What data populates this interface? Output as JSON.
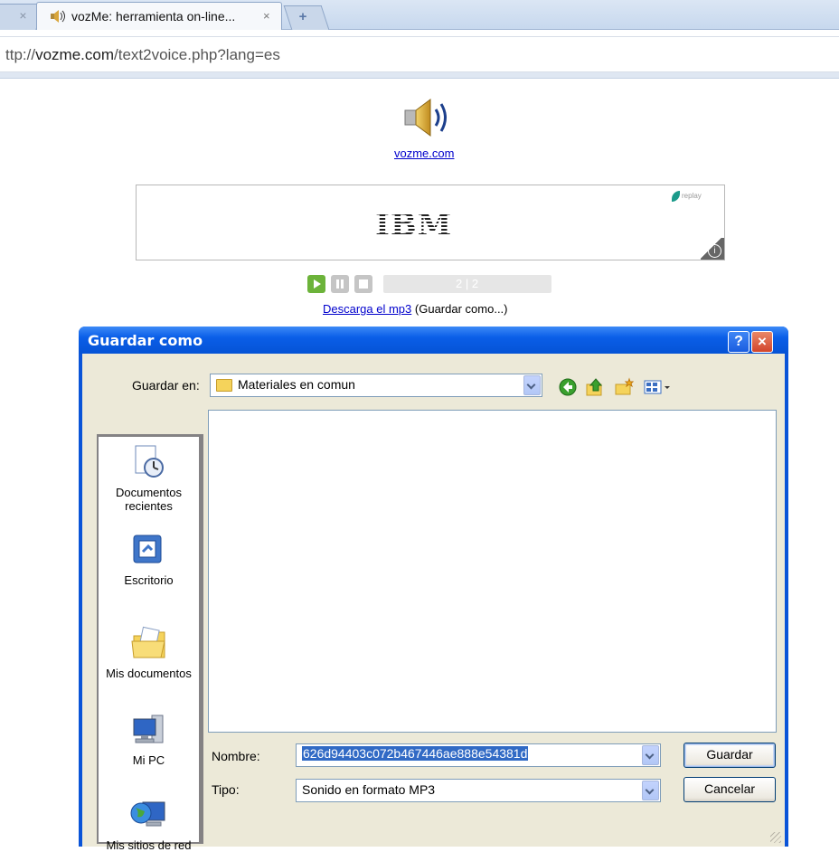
{
  "browser": {
    "closed_tab_symbol": "×",
    "active_tab_title": "vozMe: herramienta on-line...",
    "active_tab_close": "×",
    "new_tab_symbol": "+",
    "url_prefix": "ttp://",
    "url_domain": "vozme.com",
    "url_path": "/text2voice.php?lang=es"
  },
  "page": {
    "site_link": "vozme.com",
    "ad_brand": "IBM",
    "ad_badge": "replay",
    "ad_info": "i",
    "player_counter": "2 | 2",
    "download_link": "Descarga el mp3",
    "download_hint": "(Guardar como...)"
  },
  "dialog": {
    "title": "Guardar como",
    "help_button": "?",
    "close_button": "×",
    "save_in_label": "Guardar en:",
    "save_in_value": "Materiales en comun",
    "places": [
      {
        "label": "Documentos recientes",
        "icon": "recent-documents-icon"
      },
      {
        "label": "Escritorio",
        "icon": "desktop-icon"
      },
      {
        "label": "Mis documentos",
        "icon": "my-documents-icon"
      },
      {
        "label": "Mi PC",
        "icon": "my-computer-icon"
      },
      {
        "label": "Mis sitios de red",
        "icon": "network-places-icon"
      }
    ],
    "filename_label": "Nombre:",
    "filename_value": "626d94403c072b467446ae888e54381d",
    "type_label": "Tipo:",
    "type_value": "Sonido en formato MP3",
    "save_button": "Guardar",
    "cancel_button": "Cancelar"
  },
  "colors": {
    "titlebar": "#0a5ee8",
    "dialog_face": "#ece9d8",
    "link": "#0000cc",
    "play_green": "#6cb33a",
    "selection": "#316ac5"
  }
}
